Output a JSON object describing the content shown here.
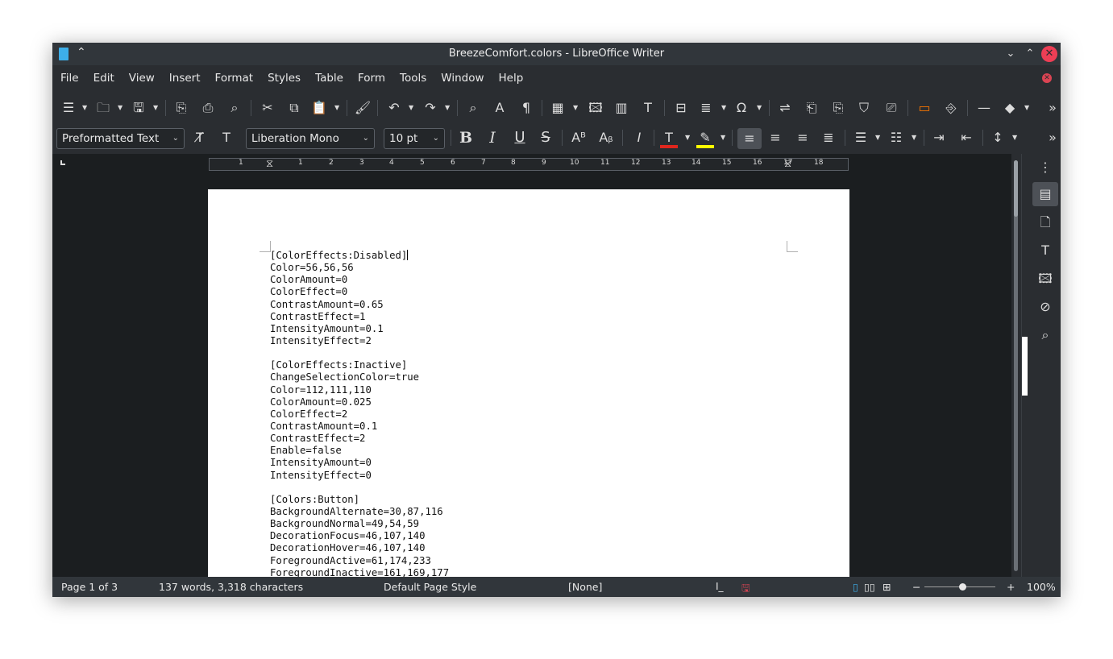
{
  "window": {
    "title": "BreezeComfort.colors - LibreOffice Writer",
    "keep_above_glyph": "⌃",
    "minimize_glyph": "⌄",
    "maximize_glyph": "⌃",
    "close_glyph": "✕"
  },
  "menu": [
    "File",
    "Edit",
    "View",
    "Insert",
    "Format",
    "Styles",
    "Table",
    "Form",
    "Tools",
    "Window",
    "Help"
  ],
  "formatting": {
    "paragraph_style": "Preformatted Text",
    "font_name": "Liberation Mono",
    "font_size": "10 pt",
    "bold": "B",
    "italic": "I",
    "underline": "U",
    "strike": "S"
  },
  "ruler": {
    "numbers": [
      "1",
      "1",
      "2",
      "3",
      "4",
      "5",
      "6",
      "7",
      "8",
      "9",
      "10",
      "11",
      "12",
      "13",
      "14",
      "15",
      "16",
      "17",
      "18"
    ]
  },
  "document": {
    "lines": [
      "[ColorEffects:Disabled]",
      "Color=56,56,56",
      "ColorAmount=0",
      "ColorEffect=0",
      "ContrastAmount=0.65",
      "ContrastEffect=1",
      "IntensityAmount=0.1",
      "IntensityEffect=2",
      "",
      "[ColorEffects:Inactive]",
      "ChangeSelectionColor=true",
      "Color=112,111,110",
      "ColorAmount=0.025",
      "ColorEffect=2",
      "ContrastAmount=0.1",
      "ContrastEffect=2",
      "Enable=false",
      "IntensityAmount=0",
      "IntensityEffect=0",
      "",
      "[Colors:Button]",
      "BackgroundAlternate=30,87,116",
      "BackgroundNormal=49,54,59",
      "DecorationFocus=46,107,140",
      "DecorationHover=46,107,140",
      "ForegroundActive=61,174,233",
      "ForegroundInactive=161,169,177"
    ]
  },
  "status": {
    "page": "Page 1 of 3",
    "words": "137 words, 3,318 characters",
    "page_style": "Default Page Style",
    "language": "[None]",
    "zoom": "100%",
    "zoom_level": 1.0
  },
  "colors": {
    "accent": "#3daee9",
    "close_red": "#ed3e55",
    "font_color_bar": "#e0261d",
    "highlight_bar": "#ffff00"
  }
}
